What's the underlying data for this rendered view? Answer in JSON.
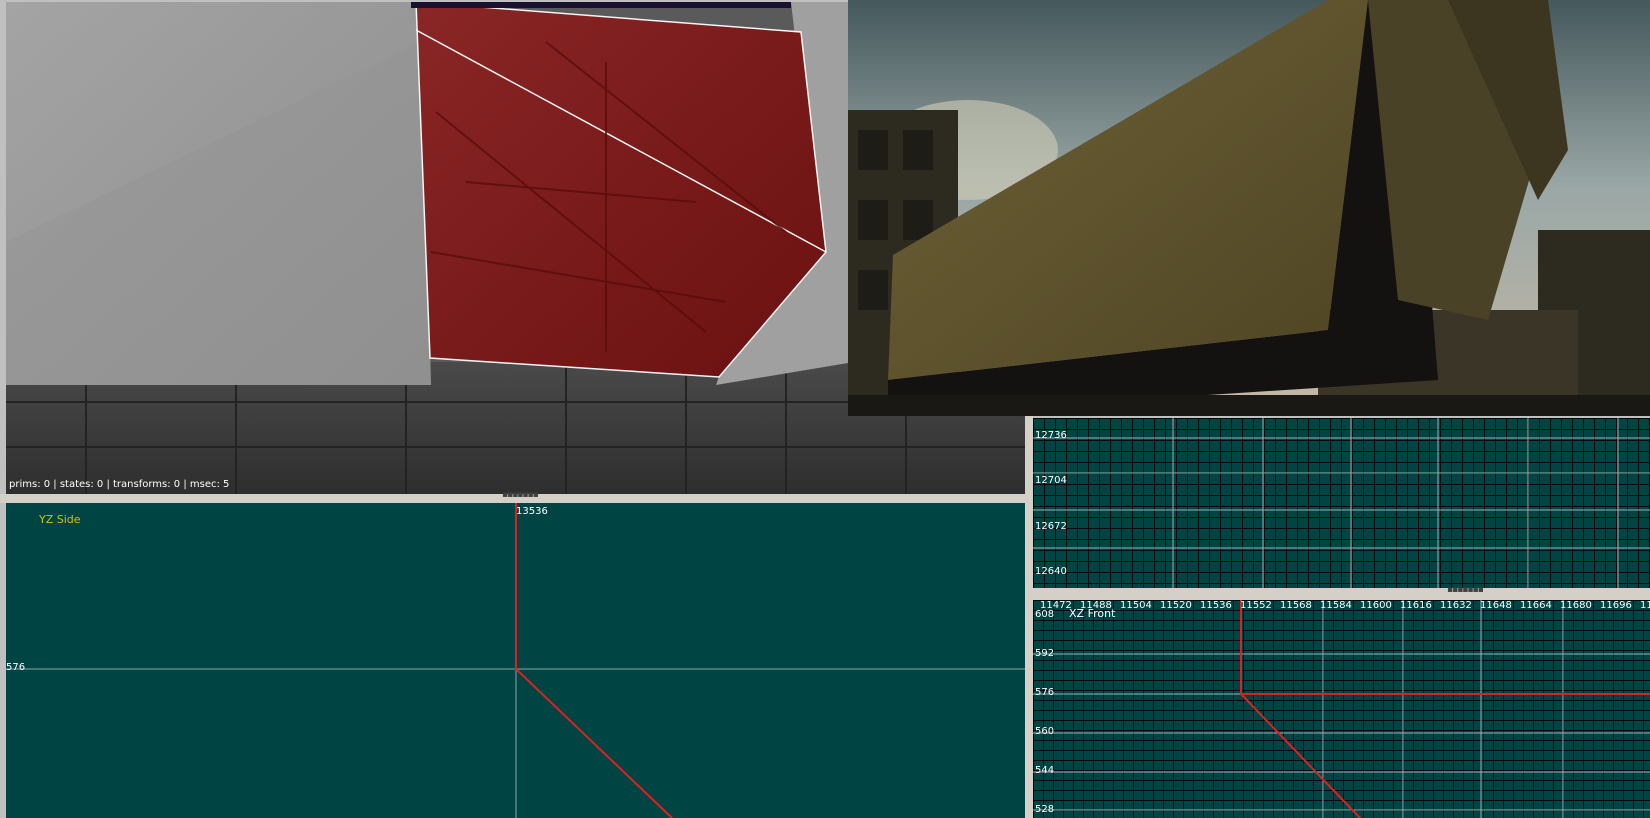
{
  "camera_view": {
    "stats": "prims: 0 | states: 0 | transforms: 0 | msec: 5"
  },
  "yz_side": {
    "title": "YZ Side",
    "top_coord": "13536",
    "left_coord": "576",
    "title_color": "#c8c800"
  },
  "top_grid": {
    "y_labels": [
      "12736",
      "12704",
      "12672",
      "12640"
    ]
  },
  "xz_front": {
    "title": "XZ Front",
    "x_labels": [
      "11472",
      "11488",
      "11504",
      "11520",
      "11536",
      "11552",
      "11568",
      "11584",
      "11600",
      "11616",
      "11632",
      "11648",
      "11664",
      "11680",
      "11696",
      "11"
    ],
    "y_labels": [
      "608",
      "592",
      "576",
      "560",
      "544",
      "528"
    ]
  },
  "colors": {
    "grid_background": "#004444",
    "brush_selected": "#cc0000",
    "splitter": "#d4d0c8"
  },
  "icons": {
    "splitter_grip": "grip-dots-icon"
  }
}
